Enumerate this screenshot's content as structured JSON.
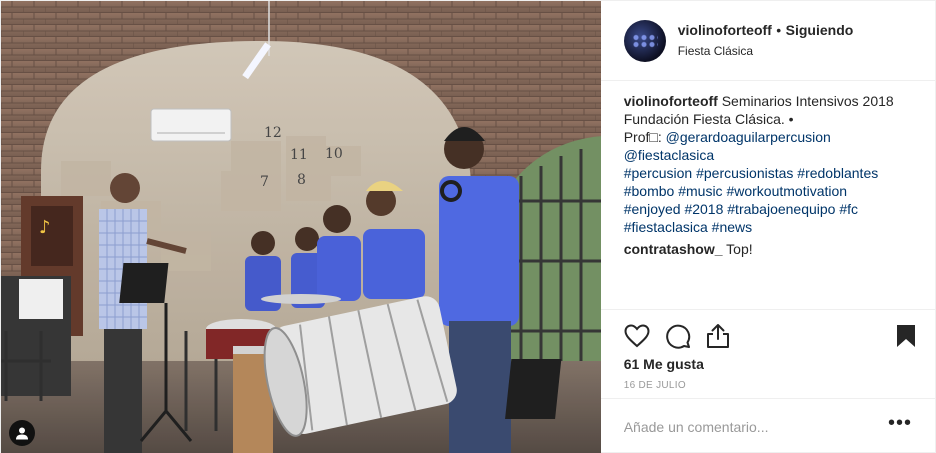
{
  "post": {
    "header": {
      "username": "violinoforteoff",
      "separator": "•",
      "follow_status": "Siguiendo",
      "location": "Fiesta Clásica"
    },
    "caption": {
      "username": "violinoforteoff",
      "line1": "Seminarios Intensivos 2018 Fundación Fiesta Clásica. •",
      "prof_prefix": "Prof□: ",
      "mention1": "@gerardoaguilarpercusion",
      "mention2": "@fiestaclasica",
      "hashtags": [
        "#percusion",
        "#percusionistas",
        "#redoblantes",
        "#bombo",
        "#music",
        "#workoutmotivation",
        "#enjoyed",
        "#2018",
        "#trabajoenequipo",
        "#fc",
        "#fiestaclasica",
        "#news"
      ]
    },
    "comments": [
      {
        "username": "contratashow_",
        "text": "Top!"
      }
    ],
    "actions": {
      "like_icon": "heart-icon",
      "comment_icon": "comment-bubble-icon",
      "share_icon": "share-icon",
      "save_icon": "bookmark-icon"
    },
    "likes_text": "61 Me gusta",
    "date": "16 DE JULIO",
    "add_comment_placeholder": "Añade un comentario...",
    "more_label": "•••",
    "photo": {
      "wall_numbers": [
        "12",
        "11",
        "10",
        "7",
        "8"
      ],
      "tag_icon": "user-tag-icon"
    }
  }
}
